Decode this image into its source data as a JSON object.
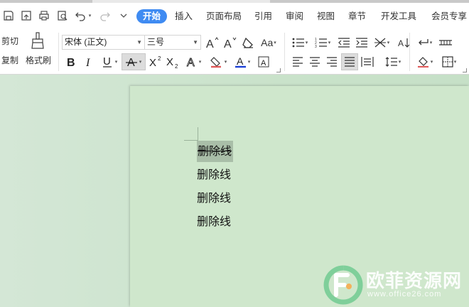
{
  "menu": {
    "tabs": [
      {
        "label": "开始",
        "active": true
      },
      {
        "label": "插入"
      },
      {
        "label": "页面布局"
      },
      {
        "label": "引用"
      },
      {
        "label": "审阅"
      },
      {
        "label": "视图"
      },
      {
        "label": "章节"
      },
      {
        "label": "开发工具"
      },
      {
        "label": "会员专享"
      }
    ]
  },
  "toolbar": {
    "cut_label": "剪切",
    "copy_label": "复制",
    "format_painter_label": "格式刷",
    "font_family": "宋体 (正文)",
    "font_size": "三号",
    "change_case_label": "Aa",
    "font_color": "#1a3fd6",
    "highlight_color": "#e05a5a",
    "shading_color": "#e05a5a"
  },
  "document": {
    "lines": [
      {
        "text": "删除线",
        "strikethrough": true,
        "selected": true
      },
      {
        "text": "删除线",
        "strikethrough": false
      },
      {
        "text": "删除线",
        "strikethrough": false
      },
      {
        "text": "删除线",
        "strikethrough": false
      }
    ]
  },
  "watermark": {
    "title": "欧菲资源网",
    "url": "www.office26.com",
    "logo_color": "#7fcf9a"
  }
}
